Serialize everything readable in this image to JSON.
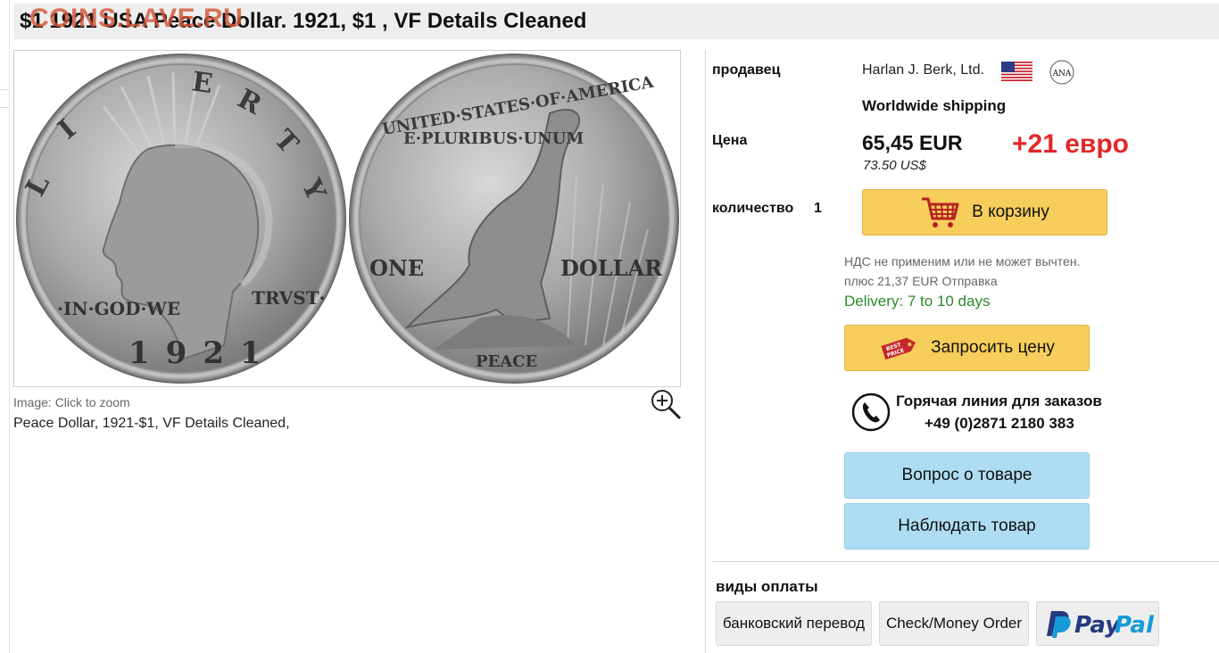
{
  "title": "$1 1921 USA Peace Dollar. 1921, $1 , VF Details Cleaned",
  "watermark": "COINS.LAVE.RU",
  "image": {
    "caption": "Image: Click to zoom",
    "description": "Peace Dollar, 1921-$1, VF Details Cleaned,",
    "obverse_text": {
      "top": "LIBERTY",
      "left": "·IN·GOD·WE",
      "right": "TRVST·",
      "year": "1921"
    },
    "reverse_text": {
      "top": "UNITED·STATES·OF·AMERICA",
      "motto": "E·PLURIBUS·UNUM",
      "left": "ONE",
      "right": "DOLLAR",
      "bottom": "PEACE"
    }
  },
  "seller": {
    "label": "продавец",
    "name": "Harlan J. Berk, Ltd.",
    "shipping": "Worldwide shipping",
    "ana_text": "ANA"
  },
  "price": {
    "label": "Цена",
    "eur": "65,45 EUR",
    "usd": "73.50 US$",
    "note": "+21 евро"
  },
  "quantity": {
    "label": "количество",
    "value": "1"
  },
  "cart_button": "В корзину",
  "vat_note": "НДС не применим или не может вычтен.",
  "shipping_cost": "плюс 21,37 EUR Отправка",
  "delivery": "Delivery: 7 to 10 days",
  "request_price_button": "Запросить цену",
  "best_price_badge": [
    "BEST",
    "PRICE"
  ],
  "hotline": {
    "title": "Горячая линия для заказов",
    "number": "+49 (0)2871 2180 383"
  },
  "question_button": "Вопрос о товаре",
  "watch_button": "Наблюдать товар",
  "payment": {
    "title": "виды оплаты",
    "options": [
      "банковский перевод",
      "Check/Money Order"
    ],
    "paypal": {
      "p": "Pay",
      "q": "Pal"
    }
  },
  "colors": {
    "cart_button": "#f7cd5b",
    "blue_button": "#aeddf3",
    "price_note": "#e0282b",
    "delivery": "#2b8a2b",
    "watermark": "#d25537"
  },
  "icons": [
    "zoom-in-icon",
    "cart-icon",
    "best-price-badge-icon",
    "phone-icon",
    "us-flag-icon",
    "ana-logo-icon",
    "paypal-logo"
  ]
}
